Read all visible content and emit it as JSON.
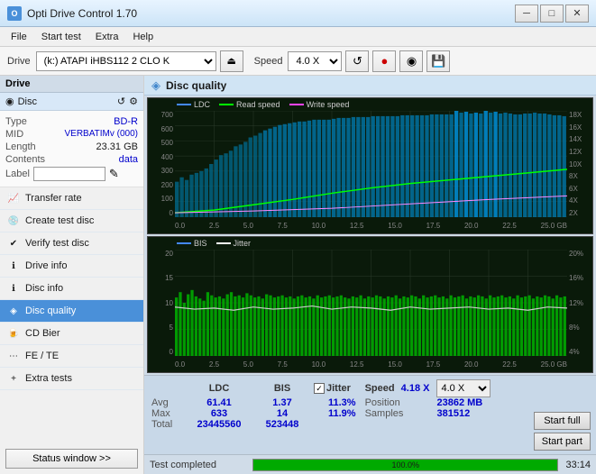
{
  "titlebar": {
    "icon": "O",
    "title": "Opti Drive Control 1.70",
    "minimize_label": "─",
    "maximize_label": "□",
    "close_label": "✕"
  },
  "menubar": {
    "items": [
      "File",
      "Start test",
      "Extra",
      "Help"
    ]
  },
  "toolbar": {
    "drive_label": "Drive",
    "drive_value": "(k:) ATAPI iHBS112  2 CLO K",
    "eject_icon": "⏏",
    "speed_label": "Speed",
    "speed_value": "4.0 X",
    "icons": [
      "↺",
      "🔴",
      "📀",
      "💾"
    ]
  },
  "sidebar": {
    "disc_section_label": "Disc",
    "disc_fields": {
      "type_label": "Type",
      "type_value": "BD-R",
      "mid_label": "MID",
      "mid_value": "VERBATIMv (000)",
      "length_label": "Length",
      "length_value": "23.31 GB",
      "contents_label": "Contents",
      "contents_value": "data",
      "label_label": "Label",
      "label_value": ""
    },
    "nav_items": [
      {
        "id": "transfer-rate",
        "label": "Transfer rate"
      },
      {
        "id": "create-test-disc",
        "label": "Create test disc"
      },
      {
        "id": "verify-test-disc",
        "label": "Verify test disc"
      },
      {
        "id": "drive-info",
        "label": "Drive info"
      },
      {
        "id": "disc-info",
        "label": "Disc info"
      },
      {
        "id": "disc-quality",
        "label": "Disc quality",
        "active": true
      },
      {
        "id": "cd-bier",
        "label": "CD Bier"
      },
      {
        "id": "fe-te",
        "label": "FE / TE"
      },
      {
        "id": "extra-tests",
        "label": "Extra tests"
      }
    ],
    "status_btn_label": "Status window >>"
  },
  "content": {
    "disc_quality_title": "Disc quality",
    "chart1": {
      "title": "LDC",
      "legend": [
        {
          "label": "LDC",
          "color": "#00aaff"
        },
        {
          "label": "Read speed",
          "color": "#00ff00"
        },
        {
          "label": "Write speed",
          "color": "#ff44ff"
        }
      ],
      "y_left": [
        "700",
        "600",
        "500",
        "400",
        "300",
        "200",
        "100",
        "0"
      ],
      "y_right": [
        "18X",
        "16X",
        "14X",
        "12X",
        "10X",
        "8X",
        "6X",
        "4X",
        "2X"
      ],
      "x_labels": [
        "0.0",
        "2.5",
        "5.0",
        "7.5",
        "10.0",
        "12.5",
        "15.0",
        "17.5",
        "20.0",
        "22.5",
        "25.0 GB"
      ]
    },
    "chart2": {
      "title": "BIS",
      "legend": [
        {
          "label": "BIS",
          "color": "#00aaff"
        },
        {
          "label": "Jitter",
          "color": "#ffffff"
        }
      ],
      "y_left": [
        "20",
        "15",
        "10",
        "5",
        "0"
      ],
      "y_right": [
        "20%",
        "16%",
        "12%",
        "8%",
        "4%"
      ],
      "x_labels": [
        "0.0",
        "2.5",
        "5.0",
        "7.5",
        "10.0",
        "12.5",
        "15.0",
        "17.5",
        "20.0",
        "22.5",
        "25.0 GB"
      ]
    },
    "stats": {
      "col_headers": [
        "LDC",
        "BIS",
        "Jitter"
      ],
      "rows": [
        {
          "label": "Avg",
          "ldc": "61.41",
          "bis": "1.37",
          "jitter": "11.3%"
        },
        {
          "label": "Max",
          "ldc": "633",
          "bis": "14",
          "jitter": "11.9%"
        },
        {
          "label": "Total",
          "ldc": "23445560",
          "bis": "523448",
          "jitter": ""
        }
      ],
      "jitter_checked": true,
      "speed_label": "Speed",
      "speed_value": "4.18 X",
      "speed_select": "4.0 X",
      "position_label": "Position",
      "position_value": "23862 MB",
      "samples_label": "Samples",
      "samples_value": "381512",
      "start_full_label": "Start full",
      "start_part_label": "Start part"
    },
    "bottom_bar": {
      "status_label": "Test completed",
      "progress_value": "100.0%",
      "time_value": "33:14"
    }
  }
}
